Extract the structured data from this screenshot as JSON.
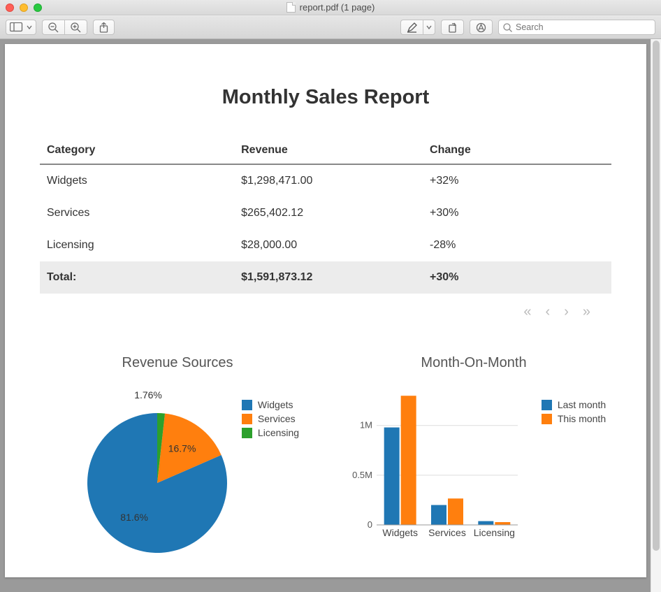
{
  "window": {
    "title": "report.pdf (1 page)"
  },
  "toolbar": {
    "search_placeholder": "Search"
  },
  "report": {
    "title": "Monthly Sales Report",
    "columns": [
      "Category",
      "Revenue",
      "Change"
    ],
    "rows": [
      {
        "category": "Widgets",
        "revenue": "$1,298,471.00",
        "change": "+32%"
      },
      {
        "category": "Services",
        "revenue": "$265,402.12",
        "change": "+30%"
      },
      {
        "category": "Licensing",
        "revenue": "$28,000.00",
        "change": "-28%"
      }
    ],
    "total": {
      "label": "Total:",
      "revenue": "$1,591,873.12",
      "change": "+30%"
    }
  },
  "colors": {
    "series1": "#1f77b4",
    "series2": "#ff7f0e",
    "series3": "#2ca02c"
  },
  "chart_data": [
    {
      "type": "pie",
      "title": "Revenue Sources",
      "categories": [
        "Widgets",
        "Services",
        "Licensing"
      ],
      "values": [
        81.6,
        16.7,
        1.76
      ],
      "value_labels": [
        "81.6%",
        "16.7%",
        "1.76%"
      ],
      "legend": [
        "Widgets",
        "Services",
        "Licensing"
      ]
    },
    {
      "type": "bar",
      "title": "Month-On-Month",
      "categories": [
        "Widgets",
        "Services",
        "Licensing"
      ],
      "series": [
        {
          "name": "Last month",
          "values": [
            980000,
            200000,
            38000
          ]
        },
        {
          "name": "This month",
          "values": [
            1298471,
            265402,
            28000
          ]
        }
      ],
      "ylim": [
        0,
        1300000
      ],
      "yticks": [
        0,
        500000,
        1000000
      ],
      "ytick_labels": [
        "0",
        "0.5M",
        "1M"
      ]
    }
  ]
}
